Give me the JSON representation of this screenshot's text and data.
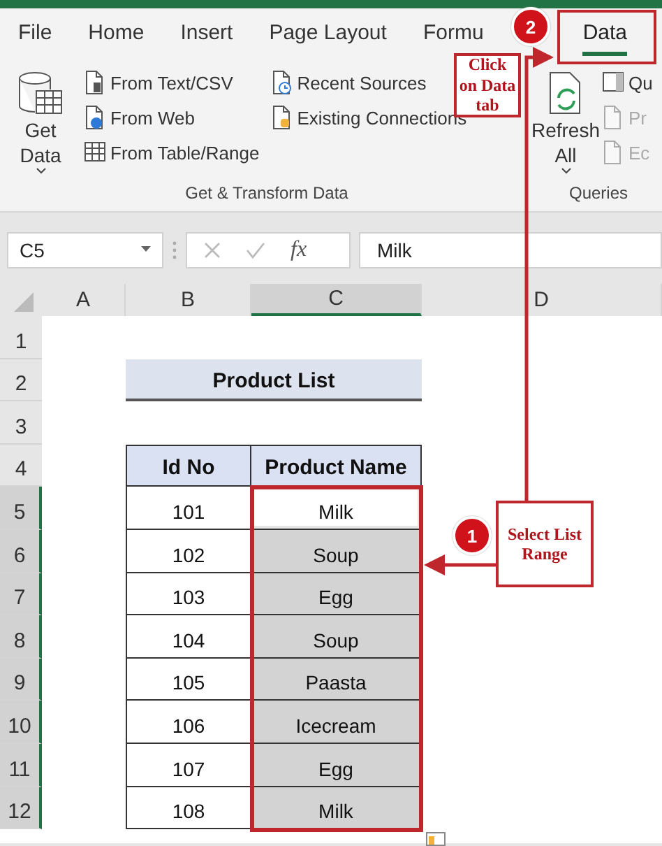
{
  "tabs": [
    {
      "label": "File",
      "selected": false
    },
    {
      "label": "Home",
      "selected": false
    },
    {
      "label": "Insert",
      "selected": false
    },
    {
      "label": "Page Layout",
      "selected": false
    },
    {
      "label": "Formu",
      "selected": false
    },
    {
      "label": "Data",
      "selected": true
    }
  ],
  "ribbon": {
    "groups": [
      {
        "label": "Get & Transform Data",
        "large": [
          {
            "label": "Get Data"
          }
        ],
        "columns": [
          [
            {
              "label": "From Text/CSV",
              "disabled": false
            },
            {
              "label": "From Web",
              "disabled": false
            },
            {
              "label": "From Table/Range",
              "disabled": false
            }
          ],
          [
            {
              "label": "Recent Sources",
              "disabled": false
            },
            {
              "label": "Existing Connections",
              "disabled": false
            }
          ]
        ]
      },
      {
        "label": "Queries",
        "large": [
          {
            "label": "Refresh All"
          }
        ],
        "columns": [
          [
            {
              "label": "Qu",
              "disabled": false
            },
            {
              "label": "Pr",
              "disabled": true
            },
            {
              "label": "Ec",
              "disabled": true
            }
          ]
        ]
      }
    ]
  },
  "formula_bar": {
    "name_box": "C5",
    "function_label": "fx",
    "value": "Milk"
  },
  "sheet": {
    "columns": [
      {
        "label": "A",
        "selected": false
      },
      {
        "label": "B",
        "selected": false
      },
      {
        "label": "C",
        "selected": true
      },
      {
        "label": "D",
        "selected": false
      }
    ],
    "rows": [
      {
        "label": "1",
        "selected": false
      },
      {
        "label": "2",
        "selected": false
      },
      {
        "label": "3",
        "selected": false
      },
      {
        "label": "4",
        "selected": false
      },
      {
        "label": "5",
        "selected": true
      },
      {
        "label": "6",
        "selected": true
      },
      {
        "label": "7",
        "selected": true
      },
      {
        "label": "8",
        "selected": true
      },
      {
        "label": "9",
        "selected": true
      },
      {
        "label": "10",
        "selected": true
      },
      {
        "label": "11",
        "selected": true
      },
      {
        "label": "12",
        "selected": true
      }
    ],
    "title": "Product List",
    "headers": [
      "Id No",
      "Product Name"
    ],
    "records": [
      {
        "id": "101",
        "name": "Milk",
        "selected": true,
        "active": true
      },
      {
        "id": "102",
        "name": "Soup",
        "selected": true,
        "active": false
      },
      {
        "id": "103",
        "name": "Egg",
        "selected": true,
        "active": false
      },
      {
        "id": "104",
        "name": "Soup",
        "selected": true,
        "active": false
      },
      {
        "id": "105",
        "name": "Paasta",
        "selected": true,
        "active": false
      },
      {
        "id": "106",
        "name": "Icecream",
        "selected": true,
        "active": false
      },
      {
        "id": "107",
        "name": "Egg",
        "selected": true,
        "active": false
      },
      {
        "id": "108",
        "name": "Milk",
        "selected": true,
        "active": false
      }
    ]
  },
  "callouts": [
    {
      "number": "2",
      "text": "Click on Data tab"
    },
    {
      "number": "1",
      "text": "Select List Range"
    }
  ]
}
